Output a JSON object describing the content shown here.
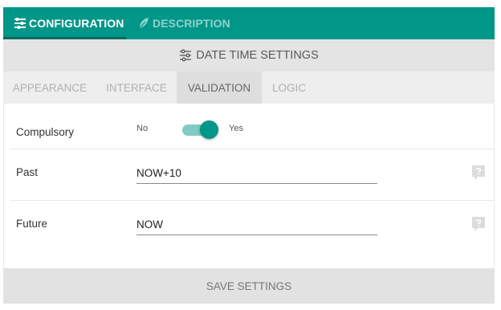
{
  "top_tabs": [
    {
      "label": "CONFIGURATION",
      "icon": "sliders-icon",
      "active": true
    },
    {
      "label": "DESCRIPTION",
      "icon": "feather-icon",
      "active": false
    }
  ],
  "panel": {
    "title": "DATE TIME SETTINGS",
    "icon": "settings-sliders-icon"
  },
  "sub_tabs": [
    {
      "label": "APPEARANCE",
      "active": false
    },
    {
      "label": "INTERFACE",
      "active": false
    },
    {
      "label": "VALIDATION",
      "active": true
    },
    {
      "label": "LOGIC",
      "active": false
    }
  ],
  "fields": {
    "compulsory": {
      "label": "Compulsory",
      "off_label": "No",
      "on_label": "Yes",
      "value": true
    },
    "past": {
      "label": "Past",
      "value": "NOW+10",
      "help_icon": "question-icon"
    },
    "future": {
      "label": "Future",
      "value": "NOW",
      "help_icon": "question-icon"
    }
  },
  "save_button": {
    "label": "SAVE SETTINGS"
  },
  "colors": {
    "accent": "#009688",
    "accent_light": "#80cbc4",
    "active_tab_underline": "#00695c"
  }
}
